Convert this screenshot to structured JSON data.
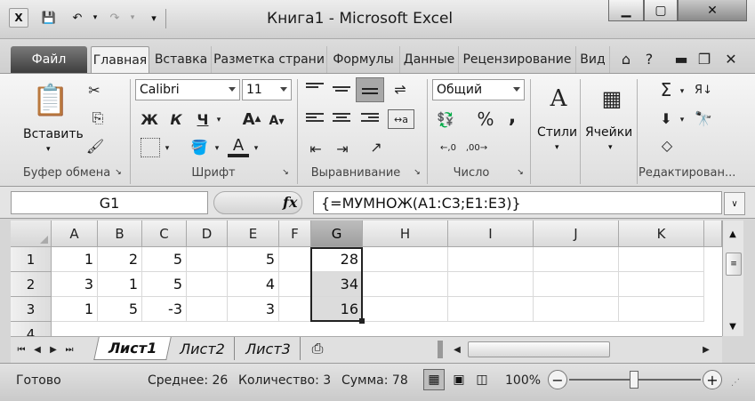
{
  "window": {
    "title": "Книга1  -  Microsoft Excel"
  },
  "tabs": [
    {
      "label": "Файл"
    },
    {
      "label": "Главная"
    },
    {
      "label": "Вставка"
    },
    {
      "label": "Разметка страни"
    },
    {
      "label": "Формулы"
    },
    {
      "label": "Данные"
    },
    {
      "label": "Рецензирование"
    },
    {
      "label": "Вид"
    }
  ],
  "ribbon": {
    "clipboard": {
      "paste_label": "Вставить",
      "group_label": "Буфер обмена"
    },
    "font": {
      "name": "Calibri",
      "size": "11",
      "bold": "Ж",
      "italic": "К",
      "underline": "Ч",
      "group_label": "Шрифт"
    },
    "alignment": {
      "group_label": "Выравнивание"
    },
    "number": {
      "format": "Общий",
      "percent": "%",
      "comma": ",",
      "group_label": "Число"
    },
    "styles": {
      "label": "Стили"
    },
    "cells": {
      "label": "Ячейки"
    },
    "editing": {
      "sigma": "Σ",
      "group_label": "Редактирован..."
    }
  },
  "formula_bar": {
    "name_box": "G1",
    "fx": "fx",
    "formula": "{=МУМНОЖ(A1:C3;E1:E3)}"
  },
  "grid": {
    "columns": [
      "A",
      "B",
      "C",
      "D",
      "E",
      "F",
      "G",
      "H",
      "I",
      "J",
      "K"
    ],
    "rows": [
      "1",
      "2",
      "3",
      "4"
    ],
    "cells": [
      [
        "1",
        "2",
        "5",
        "",
        "5",
        "",
        "28"
      ],
      [
        "3",
        "1",
        "5",
        "",
        "4",
        "",
        "34"
      ],
      [
        "1",
        "5",
        "-3",
        "",
        "3",
        "",
        "16"
      ]
    ]
  },
  "sheets": [
    {
      "label": "Лист1"
    },
    {
      "label": "Лист2"
    },
    {
      "label": "Лист3"
    }
  ],
  "status": {
    "ready": "Готово",
    "average": "Среднее: 26",
    "count": "Количество: 3",
    "sum": "Сумма: 78",
    "zoom": "100%"
  }
}
